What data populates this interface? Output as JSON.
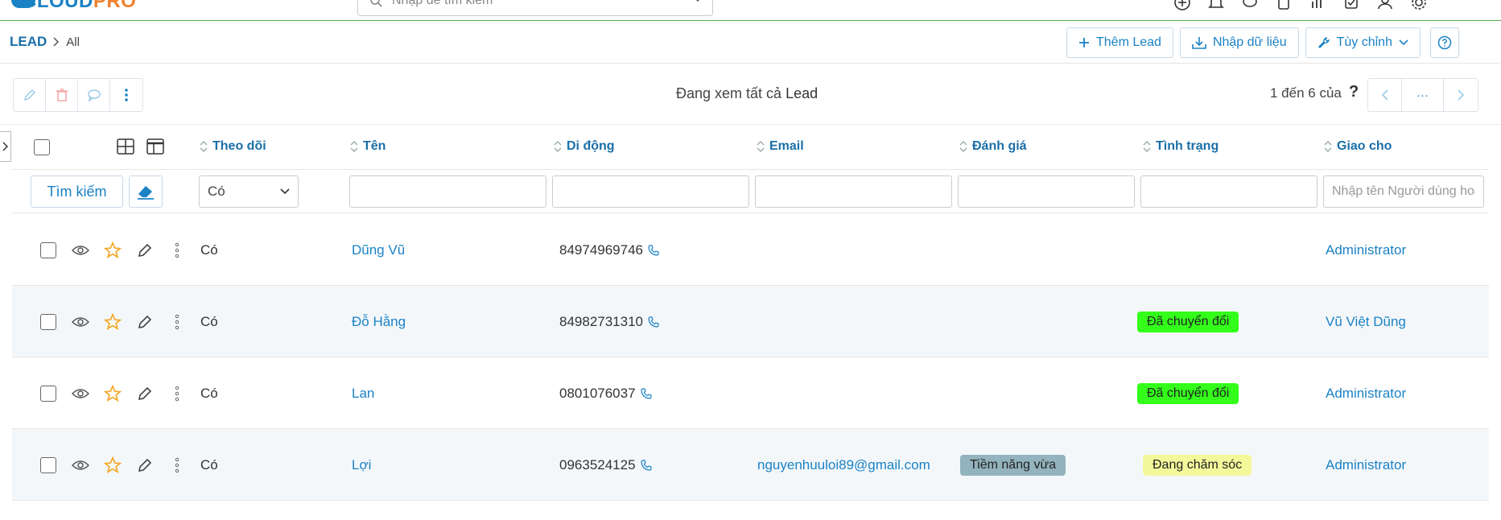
{
  "app": {
    "logo_main": "CLOUD",
    "logo_accent": "PRO",
    "search_placeholder": "Nhập để tìm kiếm"
  },
  "breadcrumb": {
    "module": "LEAD",
    "view": "All"
  },
  "actions": {
    "add": "Thêm Lead",
    "import": "Nhập dữ liệu",
    "customize": "Tùy chỉnh"
  },
  "listinfo": {
    "viewing_prefix": "Đang xem tất cả",
    "viewing_module": "Lead",
    "paging": "1 đến 6 của",
    "paging_help": "?",
    "pager_more": "···"
  },
  "columns": {
    "follow": "Theo dõi",
    "name": "Tên",
    "mobile": "Di động",
    "email": "Email",
    "rating": "Đánh giá",
    "status": "Tình trạng",
    "assigned": "Giao cho"
  },
  "filters": {
    "search_button": "Tìm kiếm",
    "follow_value": "Có",
    "assigned_placeholder": "Nhập tên Người dùng hoặc Nhóm"
  },
  "rows": [
    {
      "follow": "Có",
      "name": "Dũng Vũ",
      "mobile": "84974969746",
      "email": "",
      "rating": "",
      "status": "",
      "assigned": "Administrator"
    },
    {
      "follow": "Có",
      "name": "Đỗ Hằng",
      "mobile": "84982731310",
      "email": "",
      "rating": "",
      "status": "Đã chuyển đổi",
      "assigned": "Vũ Việt Dũng"
    },
    {
      "follow": "Có",
      "name": "Lan",
      "mobile": "0801076037",
      "email": "",
      "rating": "",
      "status": "Đã chuyển đổi",
      "assigned": "Administrator"
    },
    {
      "follow": "Có",
      "name": "Lợi",
      "mobile": "0963524125",
      "email": "nguyenhuuloi89@gmail.com",
      "rating": "Tiềm năng vừa",
      "status": "Đang chăm sóc",
      "assigned": "Administrator"
    }
  ],
  "colors": {
    "accent": "#1b82c5",
    "status_converted": "#33ff1a",
    "status_caring": "#f3f89a",
    "rating_medium": "#93b3be",
    "star": "#f5a623",
    "delete": "#f3a6a6"
  },
  "icons": {
    "edit": "pencil-icon",
    "delete": "trash-icon",
    "comment": "comment-icon",
    "more": "vertical-dots-icon",
    "view": "eye-icon",
    "star": "star-icon",
    "phone": "phone-icon"
  }
}
